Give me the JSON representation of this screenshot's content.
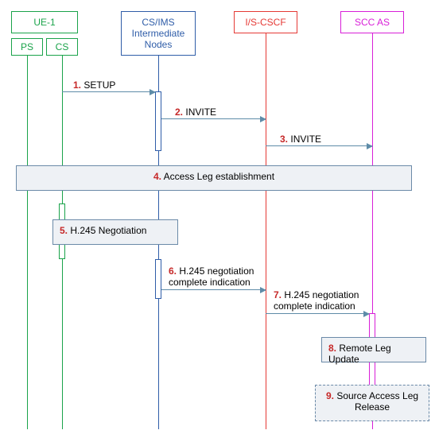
{
  "participants": {
    "ue1": {
      "label": "UE-1",
      "ps_label": "PS",
      "cs_label": "CS"
    },
    "csims": {
      "label": "CS/IMS Intermediate Nodes"
    },
    "iscscf": {
      "label": "I/S-CSCF"
    },
    "sccas": {
      "label": "SCC AS"
    }
  },
  "messages": {
    "m1": {
      "num": "1.",
      "label": "SETUP"
    },
    "m2": {
      "num": "2.",
      "label": "INVITE"
    },
    "m3": {
      "num": "3.",
      "label": "INVITE"
    },
    "m4": {
      "num": "4.",
      "label": "Access Leg establishment"
    },
    "m5": {
      "num": "5.",
      "label": "H.245 Negotiation"
    },
    "m6": {
      "num": "6.",
      "label": "H.245 negotiation complete indication"
    },
    "m7": {
      "num": "7.",
      "label": "H.245 negotiation complete indication"
    },
    "m8": {
      "num": "8.",
      "label": "Remote Leg Update"
    },
    "m9": {
      "num": "9.",
      "label": "Source Access Leg Release"
    }
  },
  "colors": {
    "ue": "#1aa34a",
    "csims": "#2f5da8",
    "iscscf": "#e53935",
    "sccas": "#d81fd8",
    "boxborder": "#6b8aa8",
    "boxfill": "#eef1f5",
    "arrow": "#5e8ca8"
  },
  "chart_data": {
    "type": "sequence-diagram",
    "participants": [
      "UE-1 (PS)",
      "UE-1 (CS)",
      "CS/IMS Intermediate Nodes",
      "I/S-CSCF",
      "SCC AS"
    ],
    "steps": [
      {
        "n": 1,
        "from": "UE-1 (CS)",
        "to": "CS/IMS Intermediate Nodes",
        "text": "SETUP",
        "kind": "message"
      },
      {
        "n": 2,
        "from": "CS/IMS Intermediate Nodes",
        "to": "I/S-CSCF",
        "text": "INVITE",
        "kind": "message"
      },
      {
        "n": 3,
        "from": "I/S-CSCF",
        "to": "SCC AS",
        "text": "INVITE",
        "kind": "message"
      },
      {
        "n": 4,
        "span": [
          "UE-1",
          "SCC AS"
        ],
        "text": "Access Leg establishment",
        "kind": "block"
      },
      {
        "n": 5,
        "span": [
          "UE-1 (CS)",
          "CS/IMS Intermediate Nodes"
        ],
        "text": "H.245 Negotiation",
        "kind": "block"
      },
      {
        "n": 6,
        "from": "CS/IMS Intermediate Nodes",
        "to": "I/S-CSCF",
        "text": "H.245 negotiation complete indication",
        "kind": "message"
      },
      {
        "n": 7,
        "from": "I/S-CSCF",
        "to": "SCC AS",
        "text": "H.245 negotiation complete indication",
        "kind": "message"
      },
      {
        "n": 8,
        "span": [
          "SCC AS"
        ],
        "text": "Remote Leg Update",
        "kind": "block"
      },
      {
        "n": 9,
        "span": [
          "SCC AS"
        ],
        "text": "Source Access Leg Release",
        "kind": "block-dashed"
      }
    ]
  }
}
